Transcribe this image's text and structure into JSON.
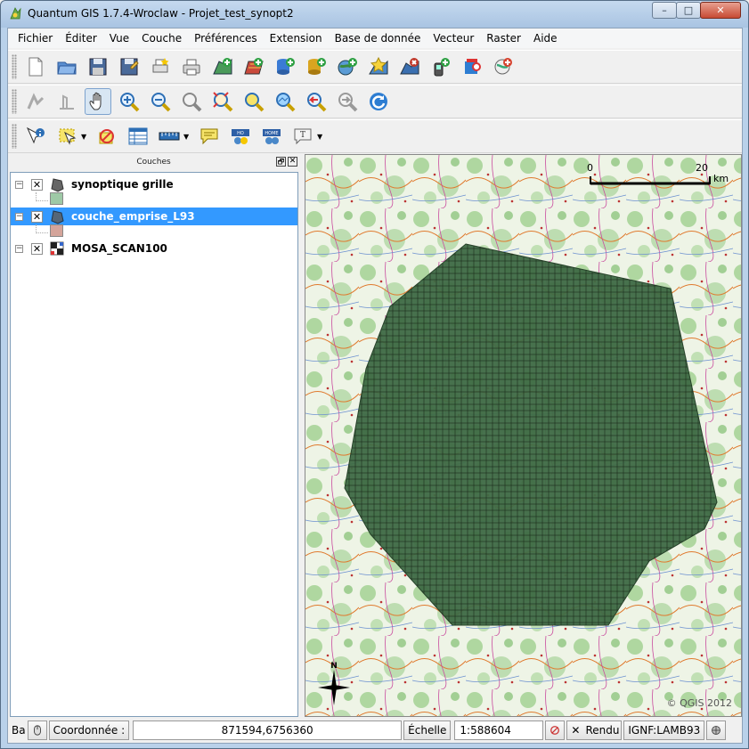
{
  "window": {
    "title": "Quantum GIS 1.7.4-Wroclaw - Projet_test_synopt2",
    "controls": {
      "minimize": "–",
      "maximize": "□",
      "close": "✕"
    }
  },
  "menu": [
    "Fichier",
    "Éditer",
    "Vue",
    "Couche",
    "Préférences",
    "Extension",
    "Base de donnée",
    "Vecteur",
    "Raster",
    "Aide"
  ],
  "toolbars": {
    "file": [
      "new-project-icon",
      "open-project-icon",
      "save-project-icon",
      "save-as-icon",
      "new-print-composer-icon",
      "print-icon"
    ],
    "layers": [
      "add-vector-layer-icon",
      "add-raster-layer-icon",
      "add-postgis-layer-icon",
      "add-spatialite-layer-icon",
      "add-wms-layer-icon",
      "new-shapefile-icon",
      "remove-layer-icon",
      "add-gps-layer-icon",
      "oracle-georaster-icon",
      "add-wfs-layer-icon"
    ],
    "navigation": [
      "capture-point-icon",
      "capture-line-icon",
      "pan-icon",
      "zoom-in-icon",
      "zoom-out-icon",
      "zoom-actual-size-icon",
      "zoom-full-icon",
      "zoom-to-selection-icon",
      "zoom-to-layer-icon",
      "zoom-last-icon",
      "zoom-next-icon",
      "refresh-icon"
    ],
    "attributes": [
      "identify-icon",
      "select-icon",
      "deselect-icon",
      "attribute-table-icon",
      "measure-icon",
      "map-tips-icon",
      "new-bookmark-icon",
      "show-bookmarks-icon",
      "text-annotation-icon"
    ]
  },
  "panel": {
    "title": "Couches",
    "float_label": "🗗",
    "close_label": "✕",
    "layers": [
      {
        "name": "synoptique grille",
        "checked": true,
        "selected": false,
        "swatch": "#9ec9a6",
        "type": "vector"
      },
      {
        "name": "couche_emprise_L93",
        "checked": true,
        "selected": true,
        "swatch": "#d4a49a",
        "type": "vector"
      },
      {
        "name": "MOSA_SCAN100",
        "checked": true,
        "selected": false,
        "swatch": null,
        "type": "raster"
      }
    ]
  },
  "map": {
    "scale_start": "0",
    "scale_end": "20",
    "scale_unit": "km",
    "copyright": "© QGIS 2012",
    "north_label": "N",
    "polygon_color": "#3f6b45"
  },
  "statusbar": {
    "render_label": "Ba",
    "coord_label": "Coordonnée :",
    "coord_value": "871594,6756360",
    "scale_label": "Échelle",
    "scale_value": "1:588604",
    "render_checkbox_label": "Rendu",
    "crs": "IGNF:LAMB93"
  }
}
